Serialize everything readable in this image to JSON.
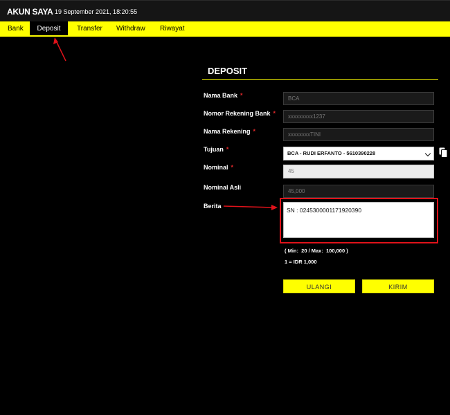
{
  "header": {
    "brand": "AKUN SAYA",
    "datetime": "19 September 2021, 18:20:55"
  },
  "nav": {
    "items": [
      {
        "label": "Bank",
        "active": false
      },
      {
        "label": "Deposit",
        "active": true
      },
      {
        "label": "Transfer",
        "active": false
      },
      {
        "label": "Withdraw",
        "active": false
      },
      {
        "label": "Riwayat",
        "active": false
      }
    ]
  },
  "deposit": {
    "title": "DEPOSIT",
    "required_mark": "*",
    "fields": {
      "nama_bank": {
        "label": "Nama Bank",
        "value": "BCA"
      },
      "nomor_rekening": {
        "label": "Nomor Rekening Bank",
        "value": "xxxxxxxxx1237"
      },
      "nama_rekening": {
        "label": "Nama Rekening",
        "value": "xxxxxxxxTINI"
      },
      "tujuan": {
        "label": "Tujuan",
        "value": "BCA - RUDI ERFANTO - 5610390228"
      },
      "nominal": {
        "label": "Nominal",
        "value": "45"
      },
      "nominal_asli": {
        "label": "Nominal Asli",
        "value": "45,000"
      },
      "berita": {
        "label": "Berita",
        "value": "SN : 0245300001171920390"
      }
    },
    "limit_text": "( Min:  20 / Max:  100,000 )",
    "rate_text": "1 = IDR 1,000",
    "buttons": {
      "reset": "ULANGI",
      "submit": "KIRIM"
    }
  },
  "colors": {
    "accent": "#ffff00",
    "background": "#000000",
    "required": "#e0282a",
    "annotation": "#e0121a"
  }
}
